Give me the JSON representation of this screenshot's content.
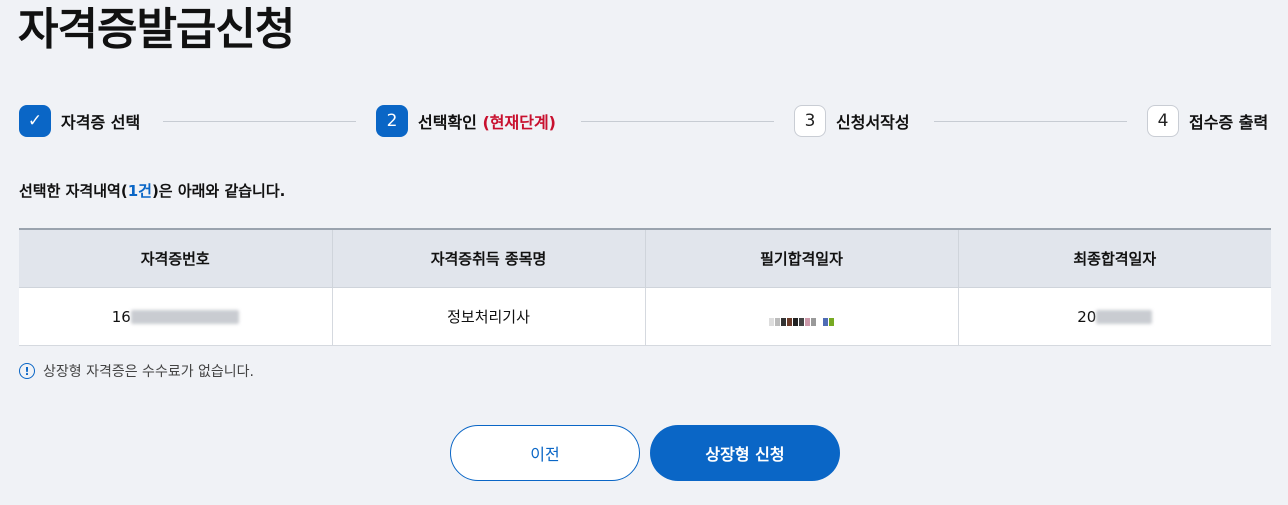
{
  "page_title": "자격증발급신청",
  "stepper": {
    "steps": [
      {
        "number": "✓",
        "label": "자격증 선택",
        "state": "done"
      },
      {
        "number": "2",
        "label": "선택확인",
        "current_label": "(현재단계)",
        "state": "current"
      },
      {
        "number": "3",
        "label": "신청서작성",
        "state": "todo"
      },
      {
        "number": "4",
        "label": "접수증 출력",
        "state": "todo"
      }
    ]
  },
  "summary": {
    "prefix": "선택한 자격내역(",
    "count": "1건",
    "suffix": ")은 아래와 같습니다."
  },
  "table": {
    "headers": [
      "자격증번호",
      "자격증취득 종목명",
      "필기합격일자",
      "최종합격일자"
    ],
    "rows": [
      {
        "cert_number_visible": "16",
        "subject": "정보처리기사",
        "written_date_visible": "",
        "final_date_visible": "20"
      }
    ]
  },
  "notice": {
    "icon": "info-circle-icon",
    "text": "상장형 자격증은 수수료가 없습니다."
  },
  "buttons": {
    "prev_label": "이전",
    "apply_label": "상장형 신청"
  },
  "colors": {
    "accent": "#0a66c6",
    "current_step": "#c8102e",
    "background": "#f0f2f6"
  }
}
